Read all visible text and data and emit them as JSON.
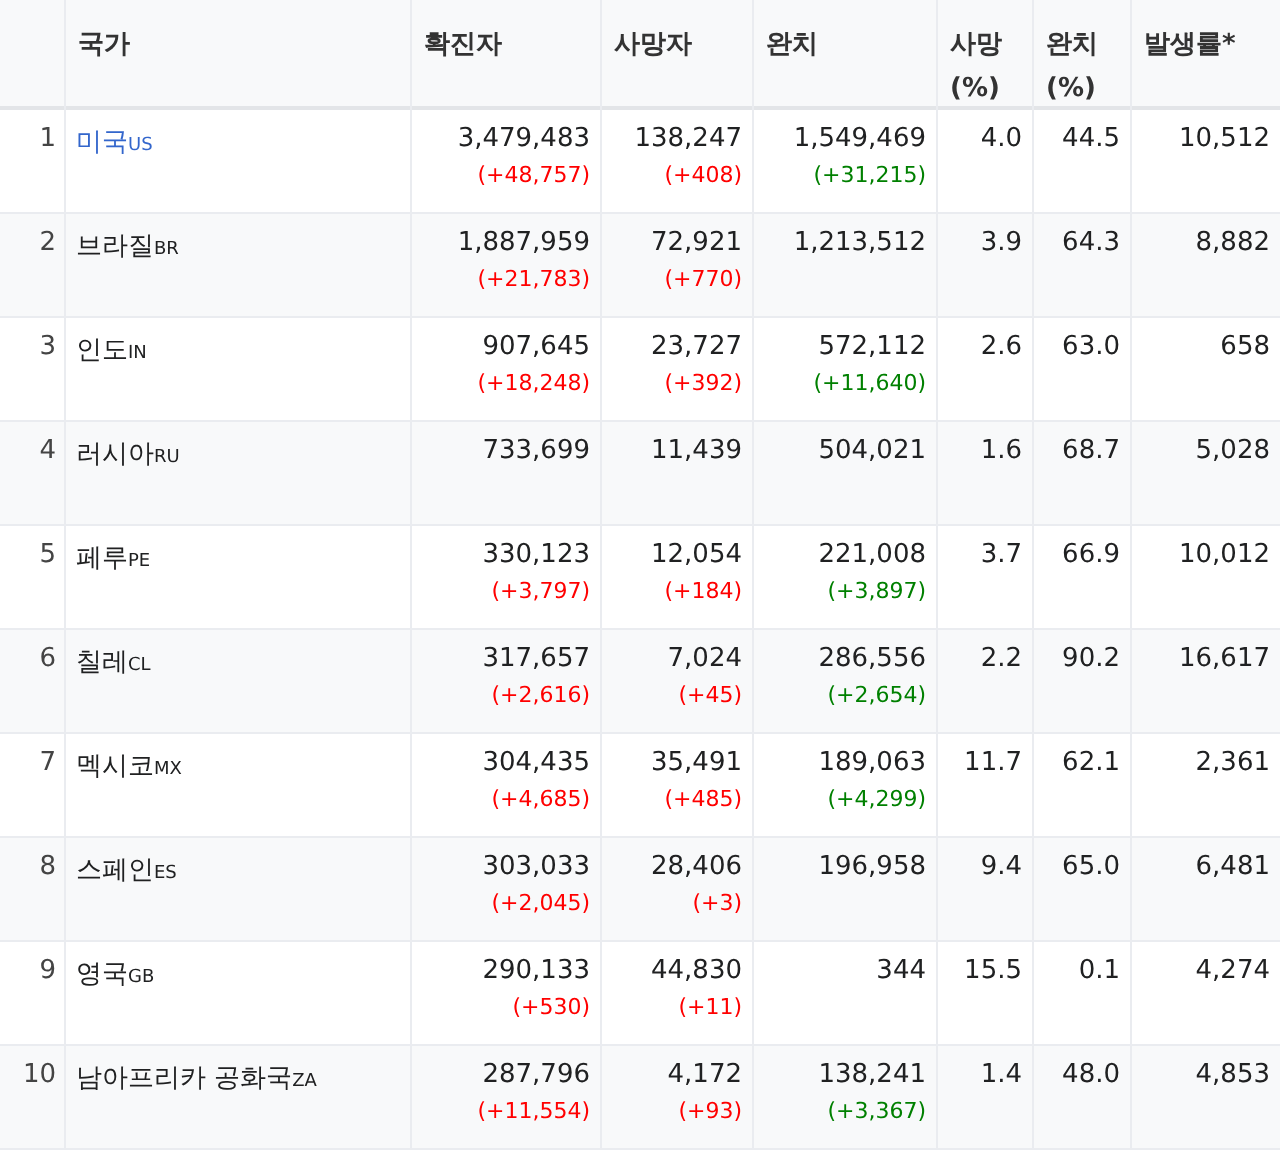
{
  "table": {
    "columns": [
      "국가",
      "확진자",
      "사망자",
      "완치",
      "사망 (%)",
      "완치 (%)",
      "발생률*"
    ],
    "rows": [
      {
        "rank": "1",
        "country": "미국",
        "code": "US",
        "link": true,
        "confirmed": "3,479,483",
        "confirmed_change": "(+48,757)",
        "deaths": "138,247",
        "deaths_change": "(+408)",
        "recovered": "1,549,469",
        "recovered_change": "(+31,215)",
        "death_pct": "4.0",
        "recovered_pct": "44.5",
        "rate": "10,512"
      },
      {
        "rank": "2",
        "country": "브라질",
        "code": "BR",
        "link": false,
        "confirmed": "1,887,959",
        "confirmed_change": "(+21,783)",
        "deaths": "72,921",
        "deaths_change": "(+770)",
        "recovered": "1,213,512",
        "death_pct": "3.9",
        "recovered_pct": "64.3",
        "rate": "8,882"
      },
      {
        "rank": "3",
        "country": "인도",
        "code": "IN",
        "link": false,
        "confirmed": "907,645",
        "confirmed_change": "(+18,248)",
        "deaths": "23,727",
        "deaths_change": "(+392)",
        "recovered": "572,112",
        "recovered_change": "(+11,640)",
        "death_pct": "2.6",
        "recovered_pct": "63.0",
        "rate": "658"
      },
      {
        "rank": "4",
        "country": "러시아",
        "code": "RU",
        "link": false,
        "confirmed": "733,699",
        "deaths": "11,439",
        "recovered": "504,021",
        "death_pct": "1.6",
        "recovered_pct": "68.7",
        "rate": "5,028"
      },
      {
        "rank": "5",
        "country": "페루",
        "code": "PE",
        "link": false,
        "confirmed": "330,123",
        "confirmed_change": "(+3,797)",
        "deaths": "12,054",
        "deaths_change": "(+184)",
        "recovered": "221,008",
        "recovered_change": "(+3,897)",
        "death_pct": "3.7",
        "recovered_pct": "66.9",
        "rate": "10,012"
      },
      {
        "rank": "6",
        "country": "칠레",
        "code": "CL",
        "link": false,
        "confirmed": "317,657",
        "confirmed_change": "(+2,616)",
        "deaths": "7,024",
        "deaths_change": "(+45)",
        "recovered": "286,556",
        "recovered_change": "(+2,654)",
        "death_pct": "2.2",
        "recovered_pct": "90.2",
        "rate": "16,617"
      },
      {
        "rank": "7",
        "country": "멕시코",
        "code": "MX",
        "link": false,
        "confirmed": "304,435",
        "confirmed_change": "(+4,685)",
        "deaths": "35,491",
        "deaths_change": "(+485)",
        "recovered": "189,063",
        "recovered_change": "(+4,299)",
        "death_pct": "11.7",
        "recovered_pct": "62.1",
        "rate": "2,361"
      },
      {
        "rank": "8",
        "country": "스페인",
        "code": "ES",
        "link": false,
        "confirmed": "303,033",
        "confirmed_change": "(+2,045)",
        "deaths": "28,406",
        "deaths_change": "(+3)",
        "recovered": "196,958",
        "death_pct": "9.4",
        "recovered_pct": "65.0",
        "rate": "6,481"
      },
      {
        "rank": "9",
        "country": "영국",
        "code": "GB",
        "link": false,
        "confirmed": "290,133",
        "confirmed_change": "(+530)",
        "deaths": "44,830",
        "deaths_change": "(+11)",
        "recovered": "344",
        "death_pct": "15.5",
        "recovered_pct": "0.1",
        "rate": "4,274"
      },
      {
        "rank": "10",
        "country": "남아프리카 공화국",
        "code": "ZA",
        "link": false,
        "confirmed": "287,796",
        "confirmed_change": "(+11,554)",
        "deaths": "4,172",
        "deaths_change": "(+93)",
        "recovered": "138,241",
        "recovered_change": "(+3,367)",
        "death_pct": "1.4",
        "recovered_pct": "48.0",
        "rate": "4,853"
      }
    ]
  }
}
